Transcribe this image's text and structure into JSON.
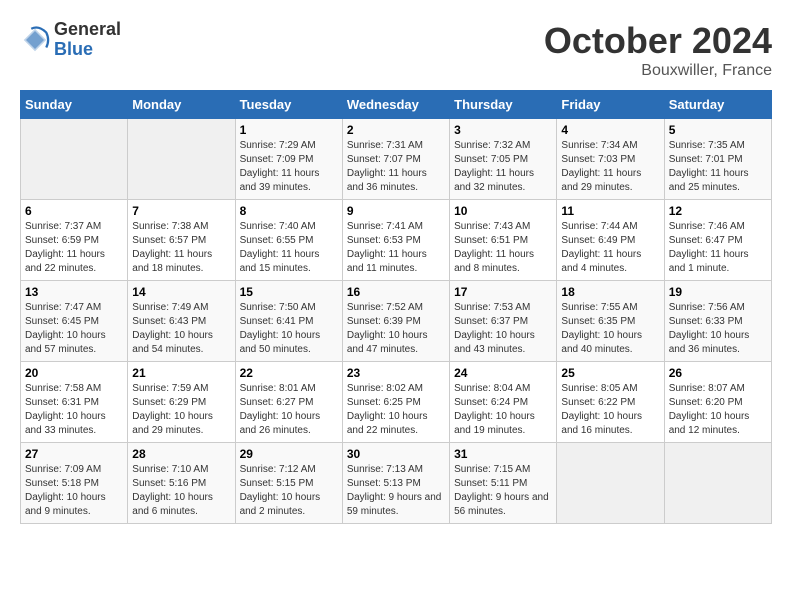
{
  "header": {
    "logo_general": "General",
    "logo_blue": "Blue",
    "month_title": "October 2024",
    "location": "Bouxwiller, France"
  },
  "weekdays": [
    "Sunday",
    "Monday",
    "Tuesday",
    "Wednesday",
    "Thursday",
    "Friday",
    "Saturday"
  ],
  "weeks": [
    [
      {
        "day": "",
        "sunrise": "",
        "sunset": "",
        "daylight": ""
      },
      {
        "day": "",
        "sunrise": "",
        "sunset": "",
        "daylight": ""
      },
      {
        "day": "1",
        "sunrise": "Sunrise: 7:29 AM",
        "sunset": "Sunset: 7:09 PM",
        "daylight": "Daylight: 11 hours and 39 minutes."
      },
      {
        "day": "2",
        "sunrise": "Sunrise: 7:31 AM",
        "sunset": "Sunset: 7:07 PM",
        "daylight": "Daylight: 11 hours and 36 minutes."
      },
      {
        "day": "3",
        "sunrise": "Sunrise: 7:32 AM",
        "sunset": "Sunset: 7:05 PM",
        "daylight": "Daylight: 11 hours and 32 minutes."
      },
      {
        "day": "4",
        "sunrise": "Sunrise: 7:34 AM",
        "sunset": "Sunset: 7:03 PM",
        "daylight": "Daylight: 11 hours and 29 minutes."
      },
      {
        "day": "5",
        "sunrise": "Sunrise: 7:35 AM",
        "sunset": "Sunset: 7:01 PM",
        "daylight": "Daylight: 11 hours and 25 minutes."
      }
    ],
    [
      {
        "day": "6",
        "sunrise": "Sunrise: 7:37 AM",
        "sunset": "Sunset: 6:59 PM",
        "daylight": "Daylight: 11 hours and 22 minutes."
      },
      {
        "day": "7",
        "sunrise": "Sunrise: 7:38 AM",
        "sunset": "Sunset: 6:57 PM",
        "daylight": "Daylight: 11 hours and 18 minutes."
      },
      {
        "day": "8",
        "sunrise": "Sunrise: 7:40 AM",
        "sunset": "Sunset: 6:55 PM",
        "daylight": "Daylight: 11 hours and 15 minutes."
      },
      {
        "day": "9",
        "sunrise": "Sunrise: 7:41 AM",
        "sunset": "Sunset: 6:53 PM",
        "daylight": "Daylight: 11 hours and 11 minutes."
      },
      {
        "day": "10",
        "sunrise": "Sunrise: 7:43 AM",
        "sunset": "Sunset: 6:51 PM",
        "daylight": "Daylight: 11 hours and 8 minutes."
      },
      {
        "day": "11",
        "sunrise": "Sunrise: 7:44 AM",
        "sunset": "Sunset: 6:49 PM",
        "daylight": "Daylight: 11 hours and 4 minutes."
      },
      {
        "day": "12",
        "sunrise": "Sunrise: 7:46 AM",
        "sunset": "Sunset: 6:47 PM",
        "daylight": "Daylight: 11 hours and 1 minute."
      }
    ],
    [
      {
        "day": "13",
        "sunrise": "Sunrise: 7:47 AM",
        "sunset": "Sunset: 6:45 PM",
        "daylight": "Daylight: 10 hours and 57 minutes."
      },
      {
        "day": "14",
        "sunrise": "Sunrise: 7:49 AM",
        "sunset": "Sunset: 6:43 PM",
        "daylight": "Daylight: 10 hours and 54 minutes."
      },
      {
        "day": "15",
        "sunrise": "Sunrise: 7:50 AM",
        "sunset": "Sunset: 6:41 PM",
        "daylight": "Daylight: 10 hours and 50 minutes."
      },
      {
        "day": "16",
        "sunrise": "Sunrise: 7:52 AM",
        "sunset": "Sunset: 6:39 PM",
        "daylight": "Daylight: 10 hours and 47 minutes."
      },
      {
        "day": "17",
        "sunrise": "Sunrise: 7:53 AM",
        "sunset": "Sunset: 6:37 PM",
        "daylight": "Daylight: 10 hours and 43 minutes."
      },
      {
        "day": "18",
        "sunrise": "Sunrise: 7:55 AM",
        "sunset": "Sunset: 6:35 PM",
        "daylight": "Daylight: 10 hours and 40 minutes."
      },
      {
        "day": "19",
        "sunrise": "Sunrise: 7:56 AM",
        "sunset": "Sunset: 6:33 PM",
        "daylight": "Daylight: 10 hours and 36 minutes."
      }
    ],
    [
      {
        "day": "20",
        "sunrise": "Sunrise: 7:58 AM",
        "sunset": "Sunset: 6:31 PM",
        "daylight": "Daylight: 10 hours and 33 minutes."
      },
      {
        "day": "21",
        "sunrise": "Sunrise: 7:59 AM",
        "sunset": "Sunset: 6:29 PM",
        "daylight": "Daylight: 10 hours and 29 minutes."
      },
      {
        "day": "22",
        "sunrise": "Sunrise: 8:01 AM",
        "sunset": "Sunset: 6:27 PM",
        "daylight": "Daylight: 10 hours and 26 minutes."
      },
      {
        "day": "23",
        "sunrise": "Sunrise: 8:02 AM",
        "sunset": "Sunset: 6:25 PM",
        "daylight": "Daylight: 10 hours and 22 minutes."
      },
      {
        "day": "24",
        "sunrise": "Sunrise: 8:04 AM",
        "sunset": "Sunset: 6:24 PM",
        "daylight": "Daylight: 10 hours and 19 minutes."
      },
      {
        "day": "25",
        "sunrise": "Sunrise: 8:05 AM",
        "sunset": "Sunset: 6:22 PM",
        "daylight": "Daylight: 10 hours and 16 minutes."
      },
      {
        "day": "26",
        "sunrise": "Sunrise: 8:07 AM",
        "sunset": "Sunset: 6:20 PM",
        "daylight": "Daylight: 10 hours and 12 minutes."
      }
    ],
    [
      {
        "day": "27",
        "sunrise": "Sunrise: 7:09 AM",
        "sunset": "Sunset: 5:18 PM",
        "daylight": "Daylight: 10 hours and 9 minutes."
      },
      {
        "day": "28",
        "sunrise": "Sunrise: 7:10 AM",
        "sunset": "Sunset: 5:16 PM",
        "daylight": "Daylight: 10 hours and 6 minutes."
      },
      {
        "day": "29",
        "sunrise": "Sunrise: 7:12 AM",
        "sunset": "Sunset: 5:15 PM",
        "daylight": "Daylight: 10 hours and 2 minutes."
      },
      {
        "day": "30",
        "sunrise": "Sunrise: 7:13 AM",
        "sunset": "Sunset: 5:13 PM",
        "daylight": "Daylight: 9 hours and 59 minutes."
      },
      {
        "day": "31",
        "sunrise": "Sunrise: 7:15 AM",
        "sunset": "Sunset: 5:11 PM",
        "daylight": "Daylight: 9 hours and 56 minutes."
      },
      {
        "day": "",
        "sunrise": "",
        "sunset": "",
        "daylight": ""
      },
      {
        "day": "",
        "sunrise": "",
        "sunset": "",
        "daylight": ""
      }
    ]
  ]
}
